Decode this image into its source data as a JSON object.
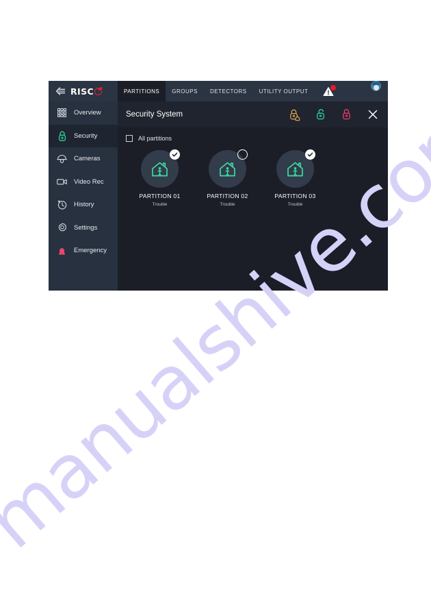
{
  "app": {
    "brand": "RISC",
    "brand_icon": "risco-o-logo",
    "back_icon": "collapse-left-icon"
  },
  "tabs": [
    {
      "label": "PARTITIONS",
      "active": true,
      "name": "tab-partitions"
    },
    {
      "label": "GROUPS",
      "active": false,
      "name": "tab-groups"
    },
    {
      "label": "DETECTORS",
      "active": false,
      "name": "tab-detectors"
    },
    {
      "label": "UTILITY OUTPUT",
      "active": false,
      "name": "tab-utility-output"
    }
  ],
  "topbar": {
    "alert_icon": "warning-triangle-icon",
    "alert_badge_color": "#e8192c",
    "avatar_icon": "user-avatar"
  },
  "sidebar": {
    "items": [
      {
        "label": "Overview",
        "icon": "grid-icon",
        "active": false
      },
      {
        "label": "Security",
        "icon": "lock-icon",
        "active": true
      },
      {
        "label": "Cameras",
        "icon": "dome-camera-icon",
        "active": false
      },
      {
        "label": "Video Rec",
        "icon": "video-camera-icon",
        "active": false
      },
      {
        "label": "History",
        "icon": "clock-icon",
        "active": false
      },
      {
        "label": "Settings",
        "icon": "gear-icon",
        "active": false
      },
      {
        "label": "Emergency",
        "icon": "siren-icon",
        "active": false
      }
    ]
  },
  "panel": {
    "title": "Security System",
    "close_icon": "close-icon",
    "actions": [
      {
        "name": "partial-arm-button",
        "icon": "lock-home-icon",
        "color": "#d9a14a"
      },
      {
        "name": "disarm-button",
        "icon": "lock-open-icon",
        "color": "#2fd598"
      },
      {
        "name": "arm-button",
        "icon": "lock-closed-icon",
        "color": "#ec3b6e"
      }
    ]
  },
  "all_partitions": {
    "label": "All partitions",
    "checked": false
  },
  "partitions": [
    {
      "name": "PARTITION 01",
      "status": "Trouble",
      "selected": true,
      "icon": "home-occupied-icon"
    },
    {
      "name": "PARTITION 02",
      "status": "Trouble",
      "selected": false,
      "icon": "home-occupied-icon"
    },
    {
      "name": "PARTITION 03",
      "status": "Trouble",
      "selected": true,
      "icon": "home-occupied-icon"
    }
  ],
  "watermark": {
    "text": "manualshive.com",
    "color_light": "#d6d2f7",
    "color_dark": "#2a2a7a"
  },
  "colors": {
    "panel_bg": "#1b1e27",
    "sidebar_bg": "#27313f",
    "topbar_bg": "#2b3442",
    "accent_green": "#2fd598",
    "accent_red": "#e4202f"
  }
}
